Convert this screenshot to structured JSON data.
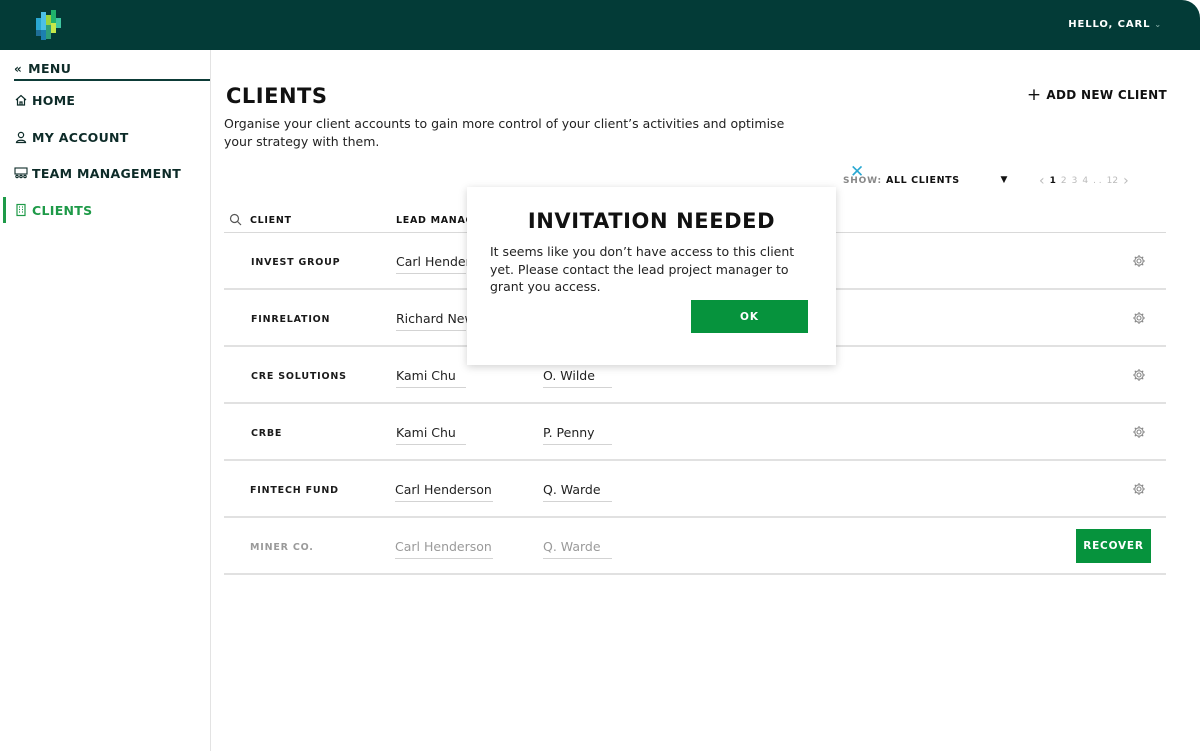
{
  "header": {
    "greeting": "HELLO, CARL",
    "user_menu_icon": "chevron-down-icon",
    "brand_color": "#033b37"
  },
  "sidebar": {
    "menu_label": "MENU",
    "items": [
      {
        "label": "HOME",
        "icon": "home-icon"
      },
      {
        "label": "MY ACCOUNT",
        "icon": "user-icon"
      },
      {
        "label": "TEAM MANAGEMENT",
        "icon": "team-icon"
      },
      {
        "label": "CLIENTS",
        "icon": "building-icon",
        "active": true
      }
    ],
    "active_color": "#1e9a48"
  },
  "main": {
    "title": "CLIENTS",
    "description": "Organise your client accounts to gain more control of your client’s activities and optimise your strategy with them.",
    "add_client_label": "ADD NEW CLIENT",
    "filter": {
      "label": "SHOW:",
      "selected": "ALL CLIENTS"
    },
    "pagination": {
      "pages": [
        "1",
        "2",
        "3",
        "4"
      ],
      "ellipsis": ". .",
      "last": "12",
      "current": "1"
    },
    "table": {
      "headers": {
        "client": "CLIENT",
        "lead_manager": "LEAD MANAGI"
      },
      "rows": [
        {
          "client": "INVEST GROUP",
          "lead": "Carl Henderson",
          "assistant": "",
          "action": "settings"
        },
        {
          "client": "FINRELATION",
          "lead": "Richard Newton",
          "assistant": "",
          "action": "settings"
        },
        {
          "client": "CRE SOLUTIONS",
          "lead": "Kami Chu",
          "assistant": "O. Wilde",
          "action": "settings"
        },
        {
          "client": "CRBE",
          "lead": "Kami Chu",
          "assistant": "P. Penny",
          "action": "settings"
        },
        {
          "client": "FINTECH FUND",
          "lead": "Carl Henderson",
          "assistant": "Q. Warde",
          "action": "settings"
        },
        {
          "client": "MINER CO.",
          "lead": "Carl Henderson",
          "assistant": "Q. Warde",
          "action": "recover"
        }
      ],
      "recover_label": "RECOVER"
    }
  },
  "modal": {
    "title": "INVITATION NEEDED",
    "body": "It seems like you don’t have access to this client yet. Please contact the lead project manager to grant you access.",
    "ok_label": "OK",
    "button_color": "#06933d"
  }
}
